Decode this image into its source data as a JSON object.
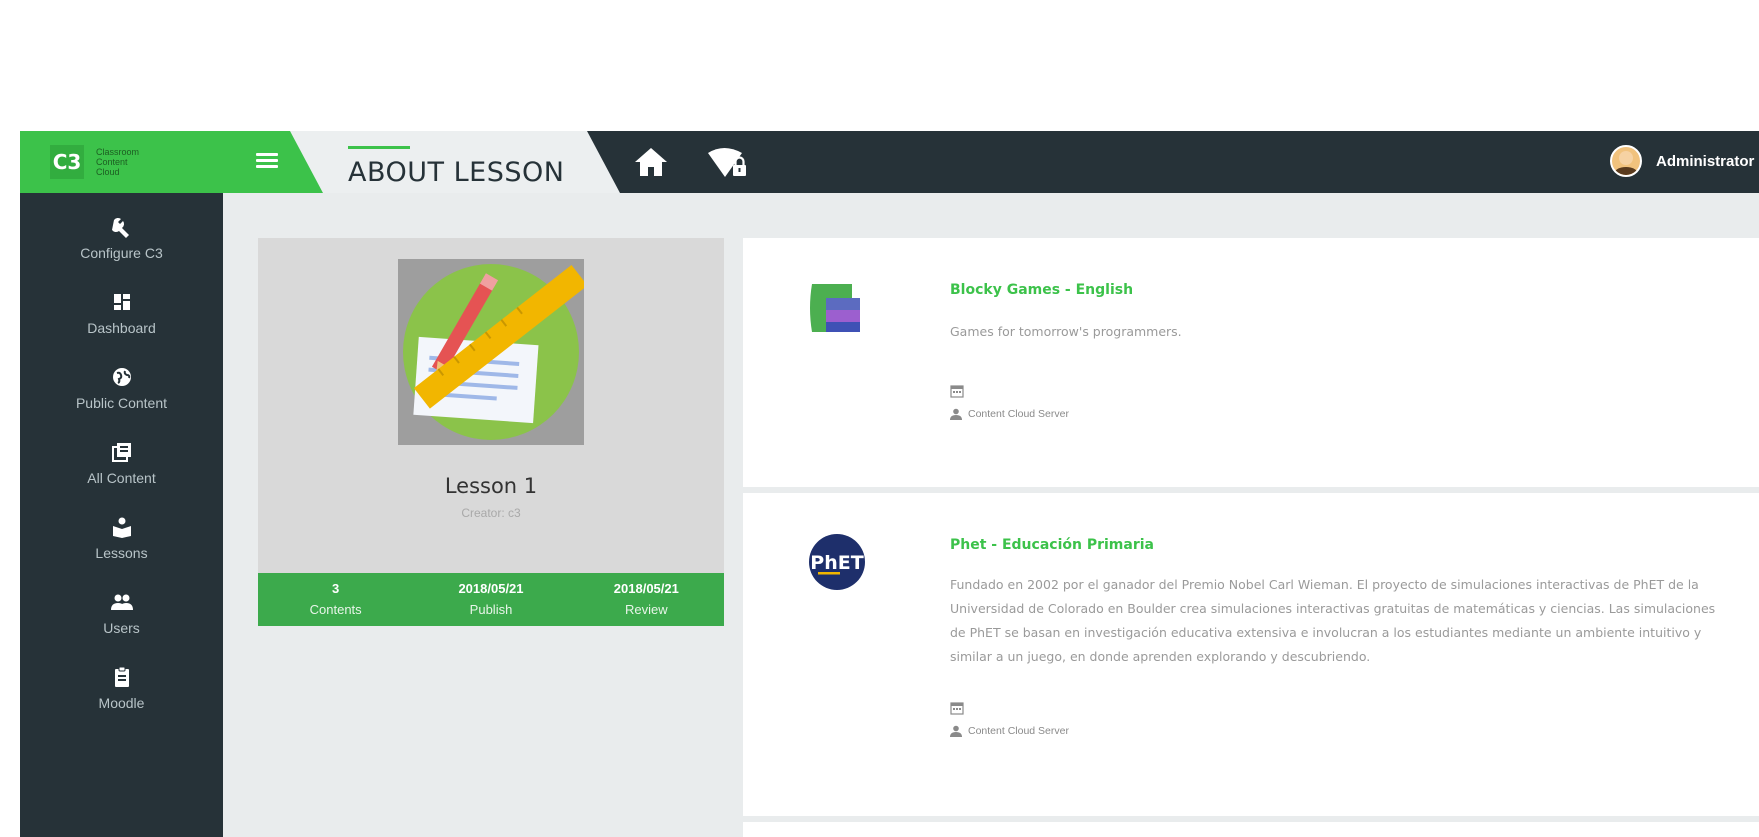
{
  "brand": {
    "badge": "C3",
    "name": "Classroom\nContent\nCloud"
  },
  "header": {
    "title": "ABOUT LESSON",
    "user": "Administrator"
  },
  "sidebar": {
    "items": [
      {
        "label": "Configure C3",
        "icon": "wrench-icon"
      },
      {
        "label": "Dashboard",
        "icon": "dashboard-icon"
      },
      {
        "label": "Public Content",
        "icon": "globe-icon"
      },
      {
        "label": "All Content",
        "icon": "library-icon"
      },
      {
        "label": "Lessons",
        "icon": "lessons-icon"
      },
      {
        "label": "Users",
        "icon": "users-icon"
      },
      {
        "label": "Moodle",
        "icon": "clipboard-icon"
      }
    ]
  },
  "lesson": {
    "title": "Lesson 1",
    "creator": "Creator: c3",
    "stats": [
      {
        "value": "3",
        "label": "Contents"
      },
      {
        "value": "2018/05/21",
        "label": "Publish"
      },
      {
        "value": "2018/05/21",
        "label": "Review"
      }
    ]
  },
  "contents": [
    {
      "title": "Blocky Games - English",
      "description": "Games for tomorrow's programmers.",
      "author": "Content Cloud Server",
      "icon": "blockly-games-icon"
    },
    {
      "title": "Phet - Educación Primaria",
      "description": "Fundado en 2002 por el ganador del Premio Nobel Carl Wieman. El proyecto de simulaciones interactivas de PhET de la Universidad de Colorado en Boulder crea simulaciones interactivas gratuitas de matemáticas y ciencias. Las simulaciones de PhET se basan en investigación educativa extensiva e involucran a los estudiantes mediante un ambiente intuitivo y similar a un juego, en donde aprenden explorando y descubriendo.",
      "author": "Content Cloud Server",
      "icon": "phet-icon",
      "icon_text": "PhET"
    }
  ],
  "colors": {
    "accent": "#3cc24a",
    "dark": "#263238",
    "stats_bar": "#3caa4c"
  }
}
